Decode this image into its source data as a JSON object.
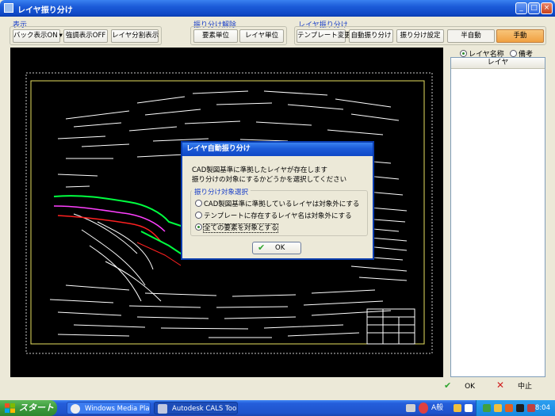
{
  "window": {
    "title": "レイヤ振り分け",
    "minimize": "_",
    "maximize": "□",
    "close": "×"
  },
  "toolbar": {
    "display": {
      "label": "表示",
      "back_display": "バック表示ON",
      "highlight": "強調表示OFF",
      "layer_split": "レイヤ分割表示"
    },
    "unassign": {
      "label": "振り分け解除",
      "element_unit": "要素単位",
      "layer_unit": "レイヤ単位"
    },
    "assign": {
      "label": "レイヤ振り分け",
      "template_change": "テンプレート変更",
      "auto_assign": "自動振り分け",
      "assign_settings": "振り分け設定",
      "semi_auto": "半自動",
      "manual": "手動"
    }
  },
  "right_panel": {
    "radio_layer_name": "レイヤ名称",
    "radio_remarks": "備考",
    "column_header": "レイヤ"
  },
  "footer": {
    "ok": "OK",
    "cancel": "中止"
  },
  "dialog": {
    "title": "レイヤ自動振り分け",
    "message_line1": "CAD製図基準に準拠したレイヤが存在します",
    "message_line2": "振り分けの対象にするかどうかを選択してください",
    "group_label": "振り分け対象選択",
    "options": [
      "CAD製図基準に準拠しているレイヤは対象外にする",
      "テンプレートに存在するレイヤ名は対象外にする",
      "全ての要素を対象とする"
    ],
    "selected_option": 2,
    "ok": "OK"
  },
  "taskbar": {
    "start": "スタート",
    "tasks": [
      "Windows Media Player",
      "Autodesk CALS Tool.."
    ],
    "ime": "A般",
    "clock": "8:04"
  },
  "colors": {
    "accent": "#0f48c6",
    "start_green": "#3c9a3b",
    "drawing_white": "#ffffff",
    "drawing_green": "#00ff40",
    "drawing_red": "#ff2020",
    "drawing_magenta": "#ff40ff",
    "frame_yellow": "#e8e060"
  }
}
